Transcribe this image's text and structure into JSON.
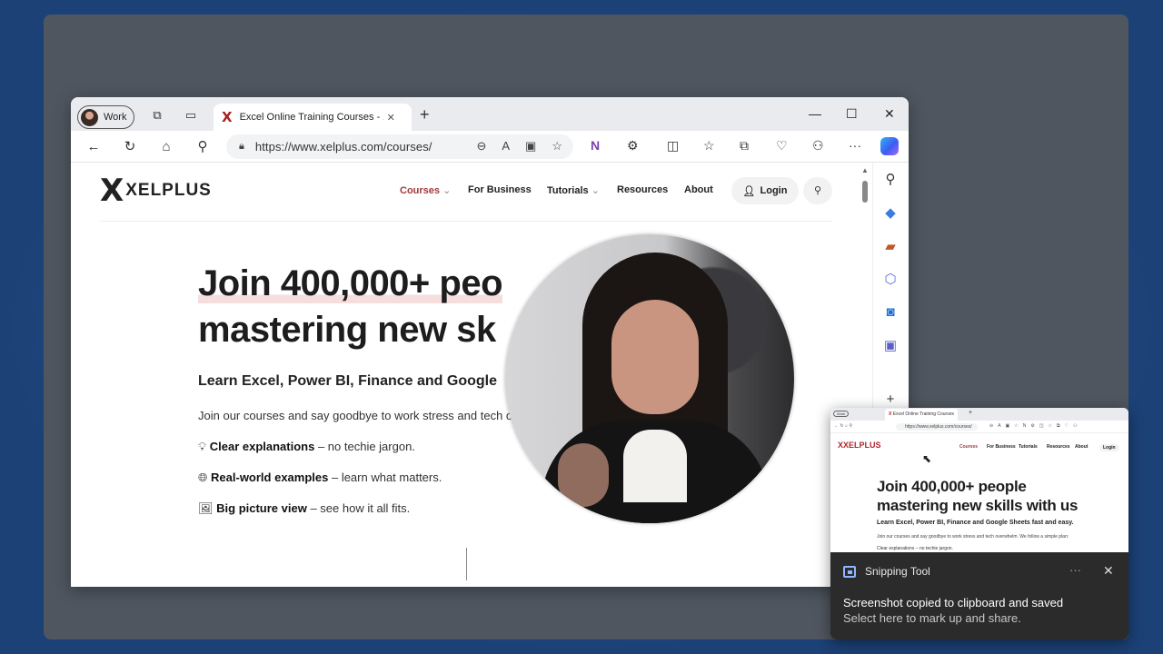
{
  "browser": {
    "profile_label": "Work",
    "tab_title": "Excel Online Training Courses - X",
    "tab_close": "✕",
    "new_tab": "+",
    "url": "https://www.xelplus.com/courses/"
  },
  "site": {
    "logo_word": "XELPLUS",
    "nav": {
      "courses": "Courses",
      "for_business": "For Business",
      "tutorials": "Tutorials",
      "resources": "Resources",
      "about": "About",
      "login": "Login"
    },
    "hero": {
      "line1": "Join 400,000+ peo",
      "line2": "mastering new sk",
      "subheading": "Learn Excel, Power BI, Finance and Google",
      "paragraph": "Join our courses and say goodbye to work stress and tech o",
      "features": [
        {
          "bold": "Clear explanations",
          "rest": " – no techie jargon."
        },
        {
          "bold": "Real-world examples",
          "rest": " – learn what matters."
        },
        {
          "bold": "Big picture view",
          "rest": " – see how it all fits."
        }
      ]
    }
  },
  "snip_preview": {
    "tab_title": "Excel Online Training Courses",
    "url": "https://www.xelplus.com/courses/",
    "logo_word": "XELPLUS",
    "nav": [
      "Courses",
      "For Business",
      "Tutorials",
      "Resources",
      "About",
      "Login"
    ],
    "h1_line1": "Join 400,000+ people",
    "h1_line2": "mastering new skills with us",
    "subheading": "Learn Excel, Power BI, Finance and Google Sheets fast and easy.",
    "paragraph": "Join our courses and say goodbye to work stress and tech overwhelm. We follow a simple plan:",
    "feature": "Clear explanations – no techie jargon."
  },
  "toast": {
    "app_name": "Snipping Tool",
    "line1": "Screenshot copied to clipboard and saved",
    "line2": "Select here to mark up and share."
  },
  "colors": {
    "brand_red": "#b3252a",
    "nav_selected": "#a13b3b",
    "toast_bg": "#2b2b2b"
  }
}
